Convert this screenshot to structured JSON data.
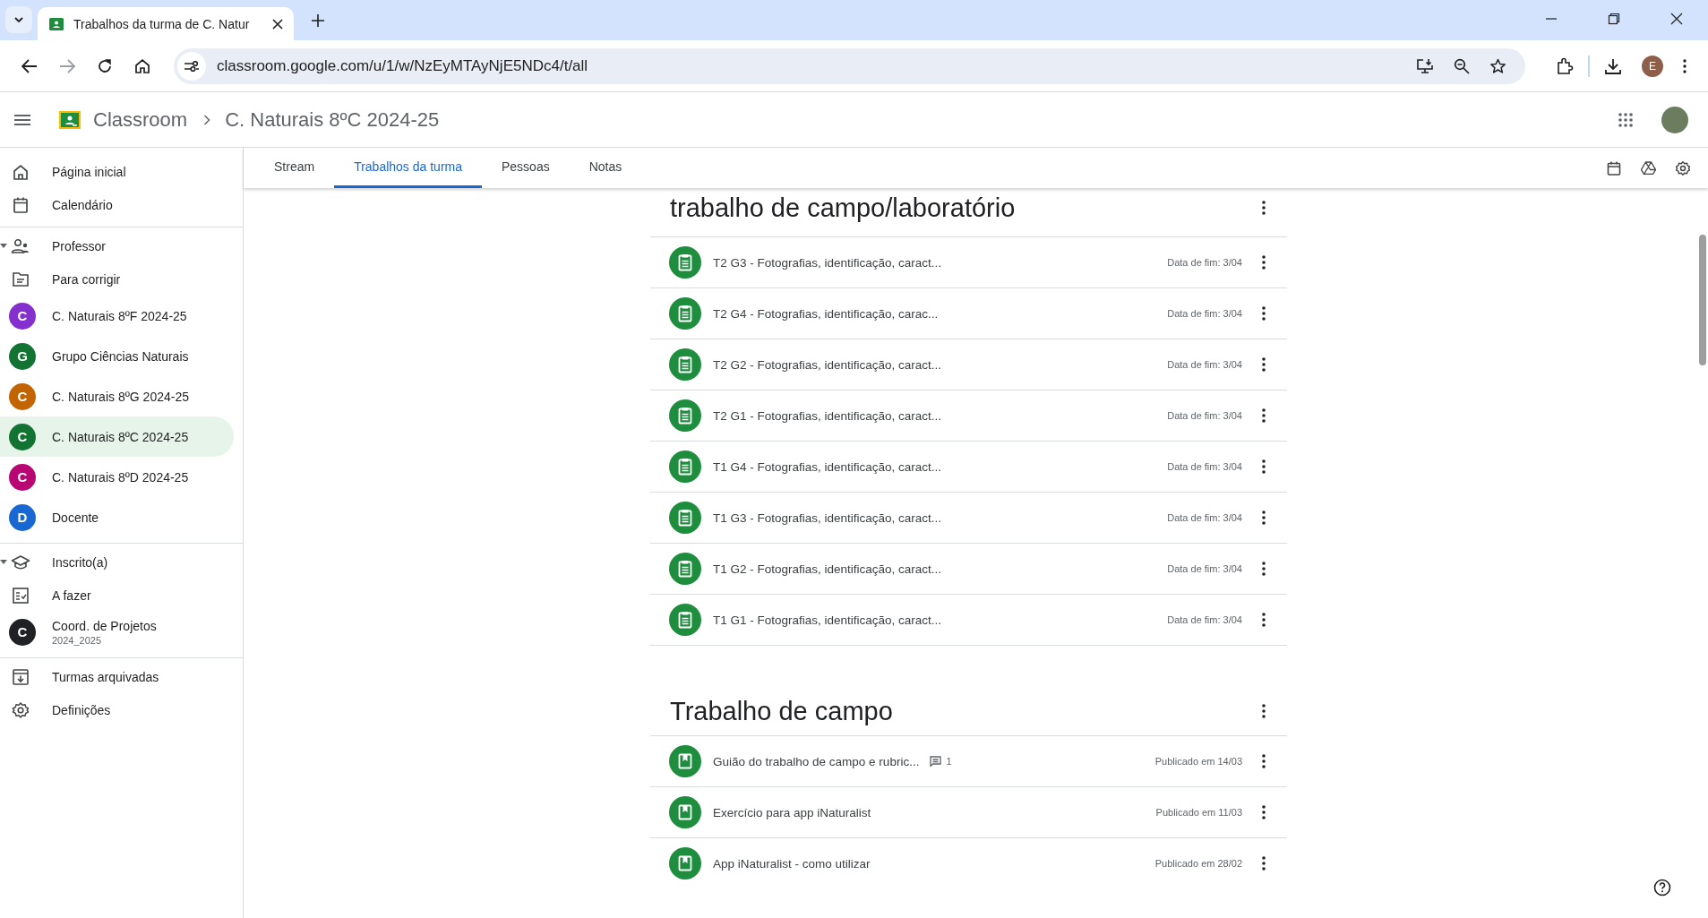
{
  "browser": {
    "tab_title": "Trabalhos da turma de C. Natur",
    "url": "classroom.google.com/u/1/w/NzEyMTAyNjE5NDc4/t/all",
    "profile_letter": "E"
  },
  "header": {
    "brand": "Classroom",
    "breadcrumb": "C. Naturais 8ºC 2024-25"
  },
  "tabs": [
    {
      "label": "Stream",
      "selected": false
    },
    {
      "label": "Trabalhos da turma",
      "selected": true
    },
    {
      "label": "Pessoas",
      "selected": false
    },
    {
      "label": "Notas",
      "selected": false
    }
  ],
  "sidebar": {
    "groups": [
      {
        "items": [
          {
            "kind": "home",
            "label": "Página inicial",
            "selected": false
          },
          {
            "kind": "calendar",
            "label": "Calendário",
            "selected": false
          }
        ]
      },
      {
        "header": {
          "kind": "teacher",
          "label": "Professor",
          "expanded": true
        },
        "items": [
          {
            "kind": "review",
            "label": "Para corrigir",
            "selected": false
          },
          {
            "kind": "class",
            "letter": "C",
            "color": "#8430ce",
            "label": "C. Naturais 8ºF 2024-25",
            "selected": false
          },
          {
            "kind": "class",
            "letter": "G",
            "color": "#137333",
            "label": "Grupo Ciências Naturais",
            "selected": false
          },
          {
            "kind": "class",
            "letter": "C",
            "color": "#c26401",
            "label": "C. Naturais 8ºG 2024-25",
            "selected": false
          },
          {
            "kind": "class",
            "letter": "C",
            "color": "#137333",
            "label": "C. Naturais 8ºC 2024-25",
            "selected": true
          },
          {
            "kind": "class",
            "letter": "C",
            "color": "#b80672",
            "label": "C. Naturais 8ºD 2024-25",
            "selected": false
          },
          {
            "kind": "class",
            "letter": "D",
            "color": "#1967d2",
            "label": "Docente",
            "selected": false
          }
        ]
      },
      {
        "header": {
          "kind": "student",
          "label": "Inscrito(a)",
          "expanded": true
        },
        "items": [
          {
            "kind": "todo",
            "label": "A fazer",
            "selected": false
          },
          {
            "kind": "class",
            "letter": "C",
            "color": "#202124",
            "label": "Coord. de Projetos",
            "subtitle": "2024_2025",
            "selected": false
          }
        ]
      },
      {
        "items": [
          {
            "kind": "archive",
            "label": "Turmas arquivadas",
            "selected": false
          },
          {
            "kind": "settings",
            "label": "Definições",
            "selected": false
          }
        ]
      }
    ]
  },
  "topics": [
    {
      "title": "trabalho de campo/laboratório",
      "items": [
        {
          "kind": "assignment",
          "title": "T2 G3 - Fotografias, identificação, caract...",
          "date": "Data de fim: 3/04"
        },
        {
          "kind": "assignment",
          "title": "T2 G4 - Fotografias, identificação, carac...",
          "date": "Data de fim: 3/04"
        },
        {
          "kind": "assignment",
          "title": "T2 G2 - Fotografias, identificação, caract...",
          "date": "Data de fim: 3/04"
        },
        {
          "kind": "assignment",
          "title": "T2 G1 - Fotografias, identificação, caract...",
          "date": "Data de fim: 3/04"
        },
        {
          "kind": "assignment",
          "title": "T1 G4 - Fotografias, identificação, caract...",
          "date": "Data de fim: 3/04"
        },
        {
          "kind": "assignment",
          "title": "T1 G3 - Fotografias, identificação, caract...",
          "date": "Data de fim: 3/04"
        },
        {
          "kind": "assignment",
          "title": "T1 G2 - Fotografias, identificação, caract...",
          "date": "Data de fim: 3/04"
        },
        {
          "kind": "assignment",
          "title": "T1 G1 - Fotografias, identificação, caract...",
          "date": "Data de fim: 3/04"
        }
      ]
    },
    {
      "title": "Trabalho de campo",
      "items": [
        {
          "kind": "material",
          "title": "Guião do trabalho de campo e rubric...",
          "comments": "1",
          "date": "Publicado em 14/03"
        },
        {
          "kind": "material",
          "title": "Exercício para app iNaturalist",
          "date": "Publicado em 11/03"
        },
        {
          "kind": "material",
          "title": "App iNaturalist - como utilizar",
          "date": "Publicado em 28/02"
        }
      ]
    }
  ]
}
